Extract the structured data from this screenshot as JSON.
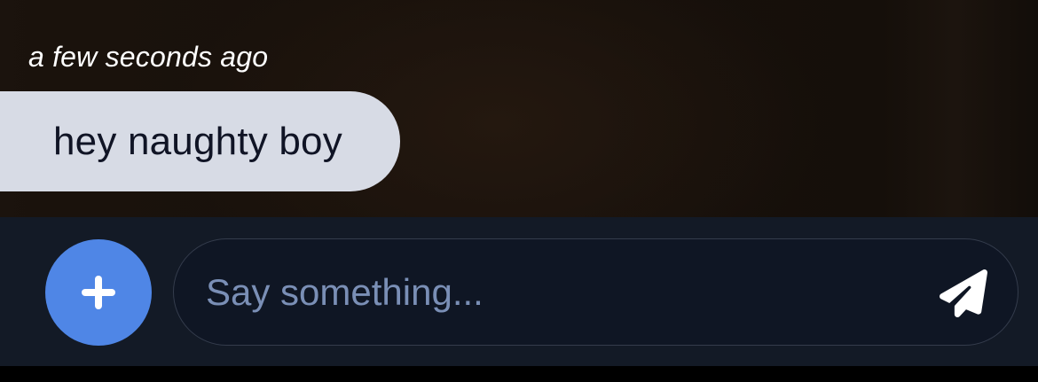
{
  "chat": {
    "timestamp": "a few seconds ago",
    "messages": [
      {
        "text": "hey naughty boy"
      }
    ]
  },
  "composer": {
    "add_icon": "plus-icon",
    "input_placeholder": "Say something...",
    "input_value": "",
    "send_icon": "paper-plane-icon"
  },
  "colors": {
    "accent": "#4f86e6",
    "bubble": "#d7dbe5",
    "composer_bg": "#131a26",
    "placeholder": "#7a8fb6"
  }
}
